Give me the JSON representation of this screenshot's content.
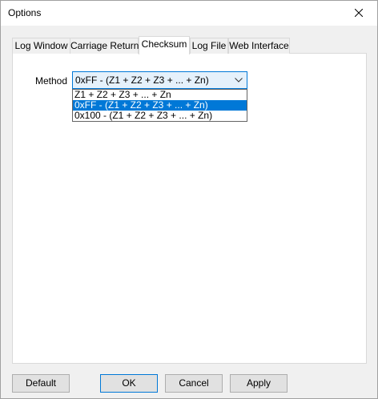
{
  "window": {
    "title": "Options"
  },
  "tabs": [
    {
      "label": "Log Window"
    },
    {
      "label": "Carriage Return"
    },
    {
      "label": "Checksum",
      "active": true
    },
    {
      "label": "Log File"
    },
    {
      "label": "Web Interface"
    }
  ],
  "checksum": {
    "method_label": "Method",
    "selected_value": "0xFF - (Z1 + Z2 + Z3 + ... + Zn)",
    "options": [
      "Z1 + Z2 + Z3 + ... + Zn",
      "0xFF - (Z1 + Z2 + Z3 + ... + Zn)",
      "0x100 - (Z1 + Z2 + Z3 + ... + Zn)"
    ],
    "highlighted_index": 1
  },
  "buttons": {
    "default_label": "Default",
    "ok_label": "OK",
    "cancel_label": "Cancel",
    "apply_label": "Apply"
  },
  "icons": {
    "close": "close-icon",
    "dropdown": "chevron-down-icon"
  },
  "colors": {
    "selection": "#0078d7",
    "panel": "#ffffff",
    "chrome": "#f0f0f0"
  }
}
